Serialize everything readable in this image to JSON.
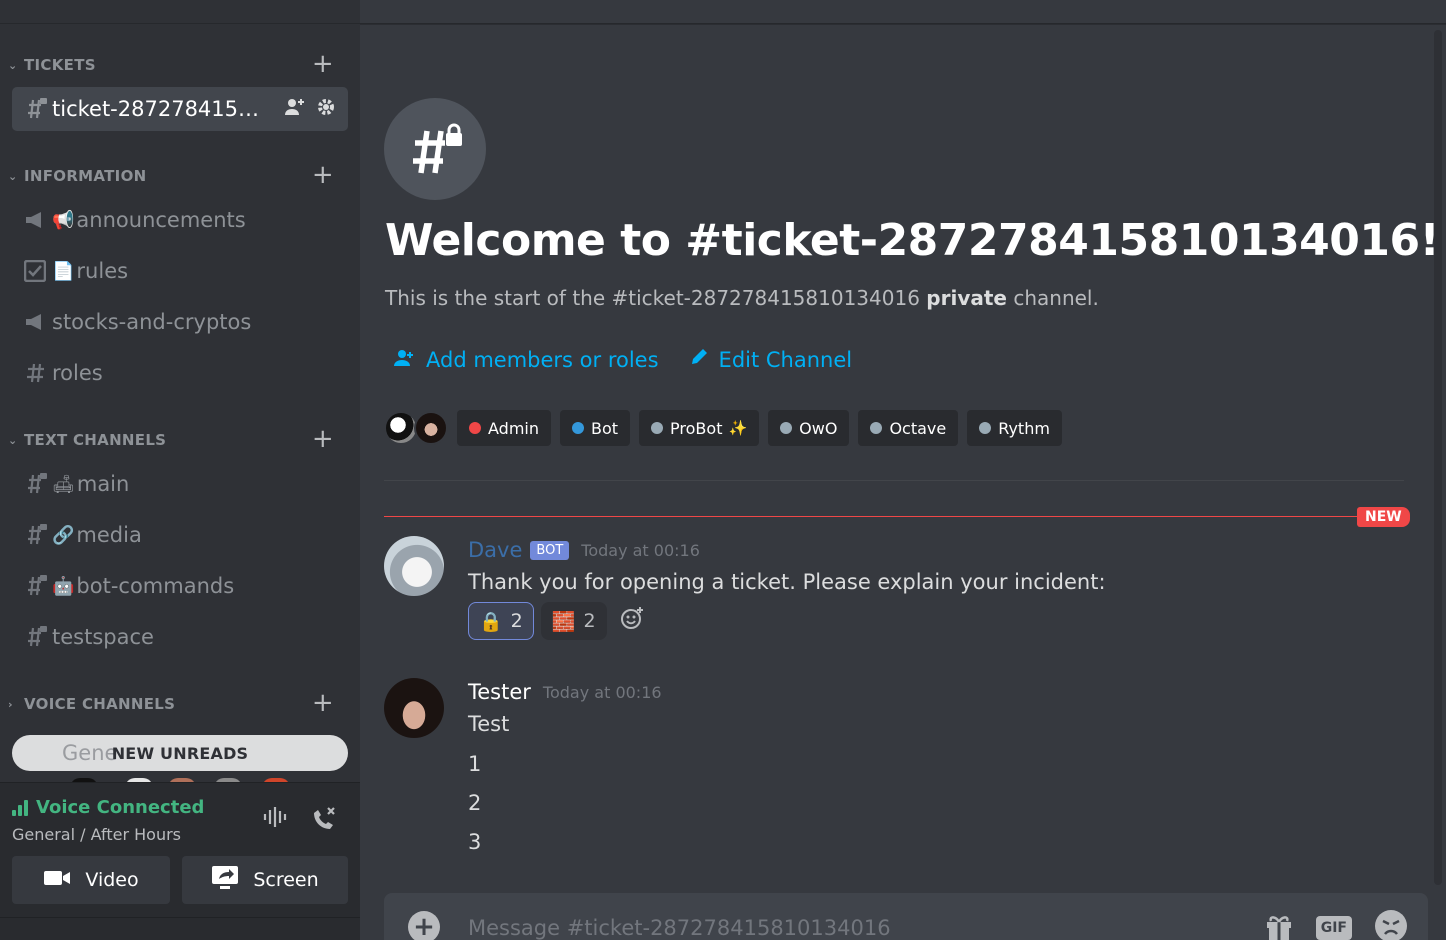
{
  "sidebar": {
    "categories": {
      "tickets": {
        "label": "TICKETS"
      },
      "information": {
        "label": "INFORMATION"
      },
      "text": {
        "label": "TEXT CHANNELS"
      },
      "voice": {
        "label": "VOICE CHANNELS"
      }
    },
    "channels": {
      "ticket": {
        "label": "ticket-2872784158..."
      },
      "announcements": {
        "emoji": "📢",
        "label": "announcements"
      },
      "rules": {
        "emoji": "📄",
        "label": "rules"
      },
      "stocks": {
        "label": "stocks-and-cryptos"
      },
      "roles": {
        "label": "roles"
      },
      "main": {
        "emoji": "🛋",
        "label": "main"
      },
      "media": {
        "emoji": "🔗",
        "label": "media"
      },
      "botcommands": {
        "emoji": "🤖",
        "label": "bot-commands"
      },
      "testspace": {
        "label": "testspace"
      }
    },
    "unread_pill": {
      "label": "NEW UNREADS",
      "behind": "Gene"
    },
    "voice_panel": {
      "status": "Voice Connected",
      "location": "General / After Hours",
      "video_label": "Video",
      "screen_label": "Screen"
    }
  },
  "welcome": {
    "title": "Welcome to #ticket-2872784158101340​16!",
    "subtitle_prefix": "This is the start of the #ticket-287278415810134016 ",
    "subtitle_bold": "private",
    "subtitle_suffix": " channel.",
    "add_members": "Add members or roles",
    "edit_channel": "Edit Channel"
  },
  "roles": [
    {
      "name": "Admin",
      "color": "#f04747"
    },
    {
      "name": "Bot",
      "color": "#3498db"
    },
    {
      "name": "ProBot",
      "color": "#99aab5",
      "emoji": "✨"
    },
    {
      "name": "OwO",
      "color": "#99aab5"
    },
    {
      "name": "Octave",
      "color": "#99aab5"
    },
    {
      "name": "Rythm",
      "color": "#99aab5"
    }
  ],
  "new_badge": "NEW",
  "messages": {
    "dave": {
      "author": "Dave",
      "author_color": "#3b6ea8",
      "tag": "BOT",
      "time": "Today at 00:16",
      "text": "Thank you for opening a ticket. Please explain your incident:",
      "reactions": [
        {
          "emoji": "🔒",
          "count": "2"
        },
        {
          "emoji": "🧱",
          "count": "2"
        }
      ]
    },
    "tester": {
      "author": "Tester",
      "time": "Today at 00:16",
      "lines": [
        "Test",
        "1",
        "2",
        "3"
      ]
    }
  },
  "composer": {
    "placeholder": "Message #ticket-287278415810134016",
    "gif_label": "GIF"
  }
}
